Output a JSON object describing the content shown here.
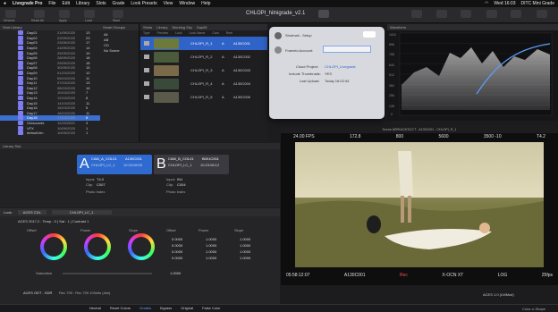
{
  "menubar": {
    "app": "Livegrade Pro",
    "items": [
      "File",
      "Edit",
      "Library",
      "Slots",
      "Grade",
      "Look Presets",
      "View",
      "Window",
      "Help"
    ],
    "clock": "Wed 16:03",
    "status_right": "DITC Mini Grade"
  },
  "window": {
    "title": "CHLOPI_hilnigrade_v2.1"
  },
  "toolbar": {
    "buttons": [
      "Devices",
      "Reset All",
      "Apply",
      "Load",
      "Store",
      "Record"
    ]
  },
  "browser": {
    "header": "Shot Library",
    "folders": [
      {
        "name": "Day01",
        "date": "21/09/2020",
        "count": "13"
      },
      {
        "name": "Day02",
        "date": "22/09/2020",
        "count": "23"
      },
      {
        "name": "Day03",
        "date": "23/09/2020",
        "count": "17"
      },
      {
        "name": "Day04",
        "date": "24/09/2020",
        "count": "14"
      },
      {
        "name": "Day05",
        "date": "25/09/2020",
        "count": "19"
      },
      {
        "name": "Day06",
        "date": "28/09/2020",
        "count": "18"
      },
      {
        "name": "Day07",
        "date": "29/09/2020",
        "count": "18"
      },
      {
        "name": "Day08",
        "date": "30/09/2020",
        "count": "15"
      },
      {
        "name": "Day09",
        "date": "01/10/2020",
        "count": "12"
      },
      {
        "name": "Day10",
        "date": "05/10/2020",
        "count": "11"
      },
      {
        "name": "Day11",
        "date": "07/10/2020",
        "count": "13"
      },
      {
        "name": "Day12",
        "date": "08/10/2020",
        "count": "16"
      },
      {
        "name": "Day13",
        "date": "10/10/2020",
        "count": "7"
      },
      {
        "name": "Day14",
        "date": "12/10/2020",
        "count": "8"
      },
      {
        "name": "Day15",
        "date": "14/10/2020",
        "count": "11"
      },
      {
        "name": "Day16",
        "date": "15/10/2020",
        "count": "5"
      },
      {
        "name": "Day17",
        "date": "16/10/2020",
        "count": "11"
      },
      {
        "name": "Day18",
        "date": "17/10/2020",
        "count": "8"
      },
      {
        "name": "Outsounds",
        "date": "11/09/2020",
        "count": "3"
      },
      {
        "name": "VFX",
        "date": "10/09/2020",
        "count": "1"
      },
      {
        "name": "default.bin",
        "date": "10/09/2020",
        "count": "1"
      }
    ]
  },
  "smart": {
    "header": "Smart Groups",
    "items": [
      "All",
      "AB",
      "CD",
      "No Scene"
    ]
  },
  "shots": {
    "header": "Shots",
    "tabs": [
      "Library",
      "Working Sky",
      "Day05",
      "B"
    ],
    "columns": [
      "Type",
      "Preview",
      "Lock",
      "Look Name",
      "Cam",
      "Reel"
    ],
    "rows": [
      {
        "name": "CHLOPI_R_1",
        "cam": "A",
        "reel": "A130C001",
        "selected": true
      },
      {
        "name": "CHLOPI_R_2",
        "cam": "A",
        "reel": "A130C002",
        "selected": false
      },
      {
        "name": "CHLOPI_R_3",
        "cam": "A",
        "reel": "A130C003",
        "selected": false
      },
      {
        "name": "CHLOPI_R_4",
        "cam": "A",
        "reel": "A130C004",
        "selected": false
      },
      {
        "name": "CHLOPI_R_5",
        "cam": "A",
        "reel": "A130C005",
        "selected": false
      }
    ]
  },
  "popup": {
    "service": "Shotmail - Setup",
    "account_label": "Frameio Account:",
    "fields": [
      {
        "label": "Cloud Project:",
        "value": "CHLOPI_Livegrade"
      },
      {
        "label": "Include Thumbnails:",
        "value": "YES"
      },
      {
        "label": "Last Upload:",
        "value": "Today 16:02:44"
      }
    ]
  },
  "waveform": {
    "header": "Waveform",
    "ticks": [
      "1023",
      "896",
      "768",
      "640",
      "512",
      "384",
      "256",
      "128",
      "0"
    ]
  },
  "viewer": {
    "header": "Scene ARRI/ACESCCT - A130C001 - CHLOPI_R_1",
    "fps": "24.00 FPS",
    "shutter": "172.8",
    "ei": "800",
    "wb": "5600",
    "kelvin": "3500 -10",
    "tint": "0",
    "iris": "T4.2",
    "timecode": "05:58:12:07",
    "clip": "A130C001",
    "rec": "Rec",
    "gamma": "X-OCN XT",
    "codec": "LOG",
    "res": "2K",
    "bit": "25fps"
  },
  "library_slot": {
    "header": "Library Slot",
    "card_a": {
      "letter": "A",
      "cam": "CAM_A_COL01",
      "reel": "A130C001",
      "look": "CHLOPI_LC_1",
      "timecode": "10:23:08:03",
      "val1": "T4.0",
      "val2": "C007"
    },
    "card_b": {
      "letter": "B",
      "cam": "CAM_B_COL01",
      "reel": "B001C001",
      "look": "CHLOPI_LC_1",
      "timecode": "10:23:08:12",
      "val1": "IN1",
      "val2": "C004"
    },
    "field_a_label": "Input:",
    "field_b_label": "Clip:",
    "note": "Photo Index"
  },
  "grade": {
    "look_label": "Look:",
    "look_value": "ACES CDL",
    "look_name": "CHLOPI_LC_1",
    "node": "ACES 2017.2 : Temp : 0 | Sat : 1 | Contrast 1",
    "wheels": [
      "Offset",
      "Power",
      "Slope"
    ],
    "slope_labels": [
      "Offset",
      "Power",
      "Slope"
    ],
    "cdl_rows": [
      [
        "0.0000",
        "1.0000",
        "1.0000"
      ],
      [
        "0.0000",
        "1.0000",
        "1.0000"
      ],
      [
        "0.0000",
        "1.0000",
        "1.0000"
      ],
      [
        "0.0000",
        "1.0000",
        "1.0000"
      ]
    ],
    "saturation_label": "Saturation",
    "saturation_value": "1.0000",
    "footer_label": "ACES ODT - SDR",
    "footer_note": "Rec 709 : Rec 709 100nits (dim)",
    "lut": "ACES 1.0 (LMMod)"
  },
  "bottom": {
    "buttons": [
      "Neutral",
      "Reset Colors",
      "Grades",
      "Bypass",
      "Original",
      "False Color"
    ],
    "right": "Color-n-Shape"
  },
  "colors": {
    "accent": "#2f63c8",
    "folder": "#7d7cf0"
  }
}
